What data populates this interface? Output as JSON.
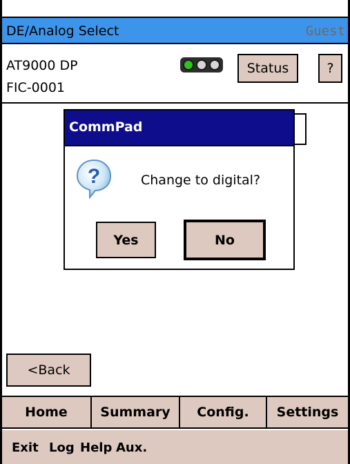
{
  "titlebar": {
    "title": "DE/Analog Select",
    "user": "Guest"
  },
  "device": {
    "model": "AT9000 DP",
    "tag": "FIC-0001",
    "status_label": "Status",
    "help_label": "?"
  },
  "traffic_light": {
    "active": "green",
    "colors": [
      "#2ec31d",
      "#d6d6d6",
      "#d6d6d6"
    ]
  },
  "dialog": {
    "title": "CommPad",
    "message": "Change to digital?",
    "yes_label": "Yes",
    "no_label": "No",
    "icon": "question-icon"
  },
  "nav": {
    "back_label": "<Back"
  },
  "tabs": [
    {
      "label": "Home"
    },
    {
      "label": "Summary"
    },
    {
      "label": "Config."
    },
    {
      "label": "Settings"
    }
  ],
  "menu": [
    {
      "label": "Exit"
    },
    {
      "label": "Log"
    },
    {
      "label": "Help"
    },
    {
      "label": "Aux."
    }
  ],
  "colors": {
    "titlebar": "#3d95eb",
    "dialog_title": "#0e0e8c",
    "button": "#ddc9bf"
  }
}
